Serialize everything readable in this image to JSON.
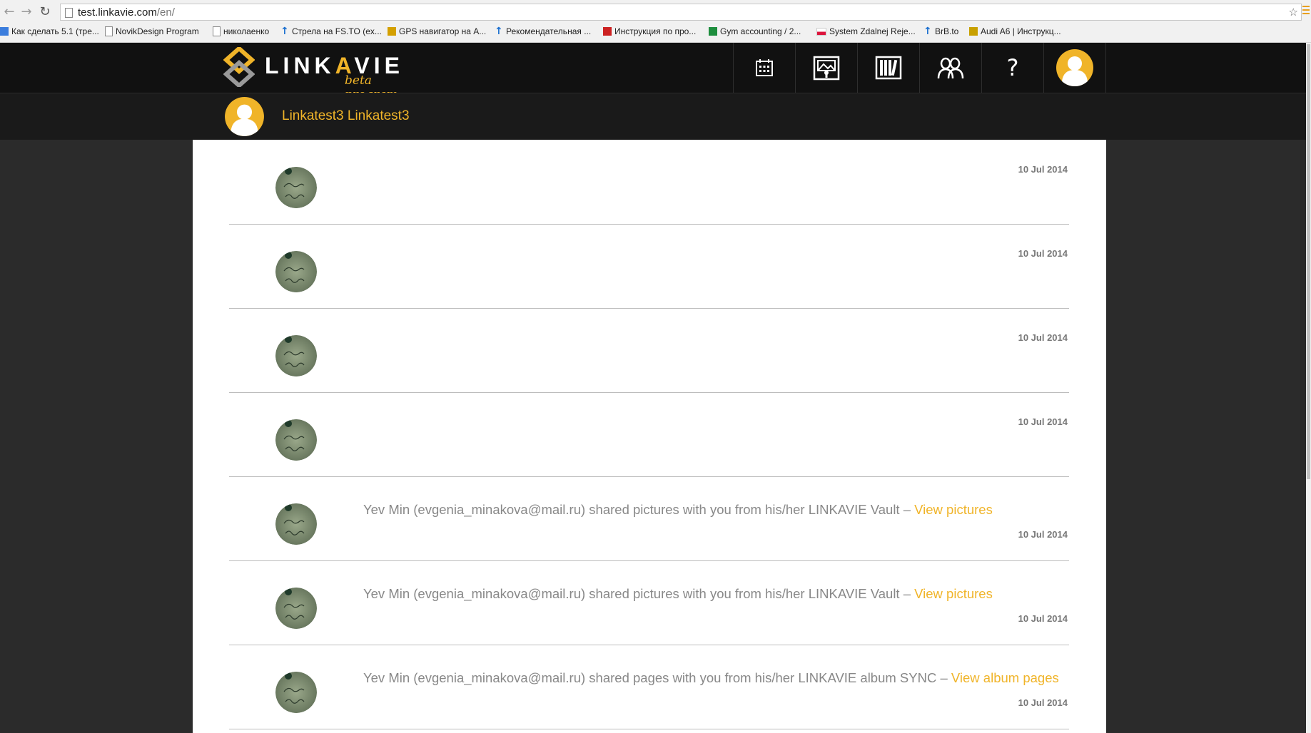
{
  "browser": {
    "url_host": "test.linkavie.com",
    "url_path": "/en/",
    "bookmarks": [
      {
        "label": "Как сделать 5.1 (тре...",
        "icon": "doc-icon",
        "color": "#3b7ddd"
      },
      {
        "label": "NovikDesign Program",
        "icon": "page-icon",
        "color": "#888888"
      },
      {
        "label": "николаенко",
        "icon": "page-icon",
        "color": "#888888"
      },
      {
        "label": "Стрела на FS.TO (ex...",
        "icon": "arrow-up-icon",
        "color": "#1a6fd0"
      },
      {
        "label": "GPS навигатор на А...",
        "icon": "figure-icon",
        "color": "#d4a000"
      },
      {
        "label": "Рекомендательная ...",
        "icon": "arrow-up-icon",
        "color": "#1a6fd0"
      },
      {
        "label": "Инструкция по про...",
        "icon": "info-icon",
        "color": "#cc2222"
      },
      {
        "label": "Gym accounting / 2...",
        "icon": "sheet-icon",
        "color": "#1e8e3e"
      },
      {
        "label": "System Zdalnej Reje...",
        "icon": "flag-icon",
        "color": "#dc143c"
      },
      {
        "label": "BrB.to",
        "icon": "arrow-up-icon",
        "color": "#1a6fd0"
      },
      {
        "label": "Audi A6 | Инструкц...",
        "icon": "car-icon",
        "color": "#c8a000"
      }
    ]
  },
  "header": {
    "logo_text_1": "LINK",
    "logo_text_a": "A",
    "logo_text_2": "VIE",
    "logo_beta": "beta program",
    "help_label": "?"
  },
  "profile": {
    "name": "Linkatest3 Linkatest3"
  },
  "feed": [
    {
      "date": "10 Jul 2014",
      "message": "",
      "link": ""
    },
    {
      "date": "10 Jul 2014",
      "message": "",
      "link": ""
    },
    {
      "date": "10 Jul 2014",
      "message": "",
      "link": ""
    },
    {
      "date": "10 Jul 2014",
      "message": "",
      "link": ""
    },
    {
      "date": "10 Jul 2014",
      "message": "Yev Min (evgenia_minakova@mail.ru) shared pictures with you from his/her LINKAVIE Vault – ",
      "link": "View pictures"
    },
    {
      "date": "10 Jul 2014",
      "message": "Yev Min (evgenia_minakova@mail.ru) shared pictures with you from his/her LINKAVIE Vault – ",
      "link": "View pictures"
    },
    {
      "date": "10 Jul 2014",
      "message": "Yev Min (evgenia_minakova@mail.ru) shared pages with you from his/her LINKAVIE album SYNC – ",
      "link": "View album pages"
    }
  ],
  "colors": {
    "accent": "#f0b429",
    "header_bg": "#111111",
    "page_bg": "#2b2b2b"
  }
}
